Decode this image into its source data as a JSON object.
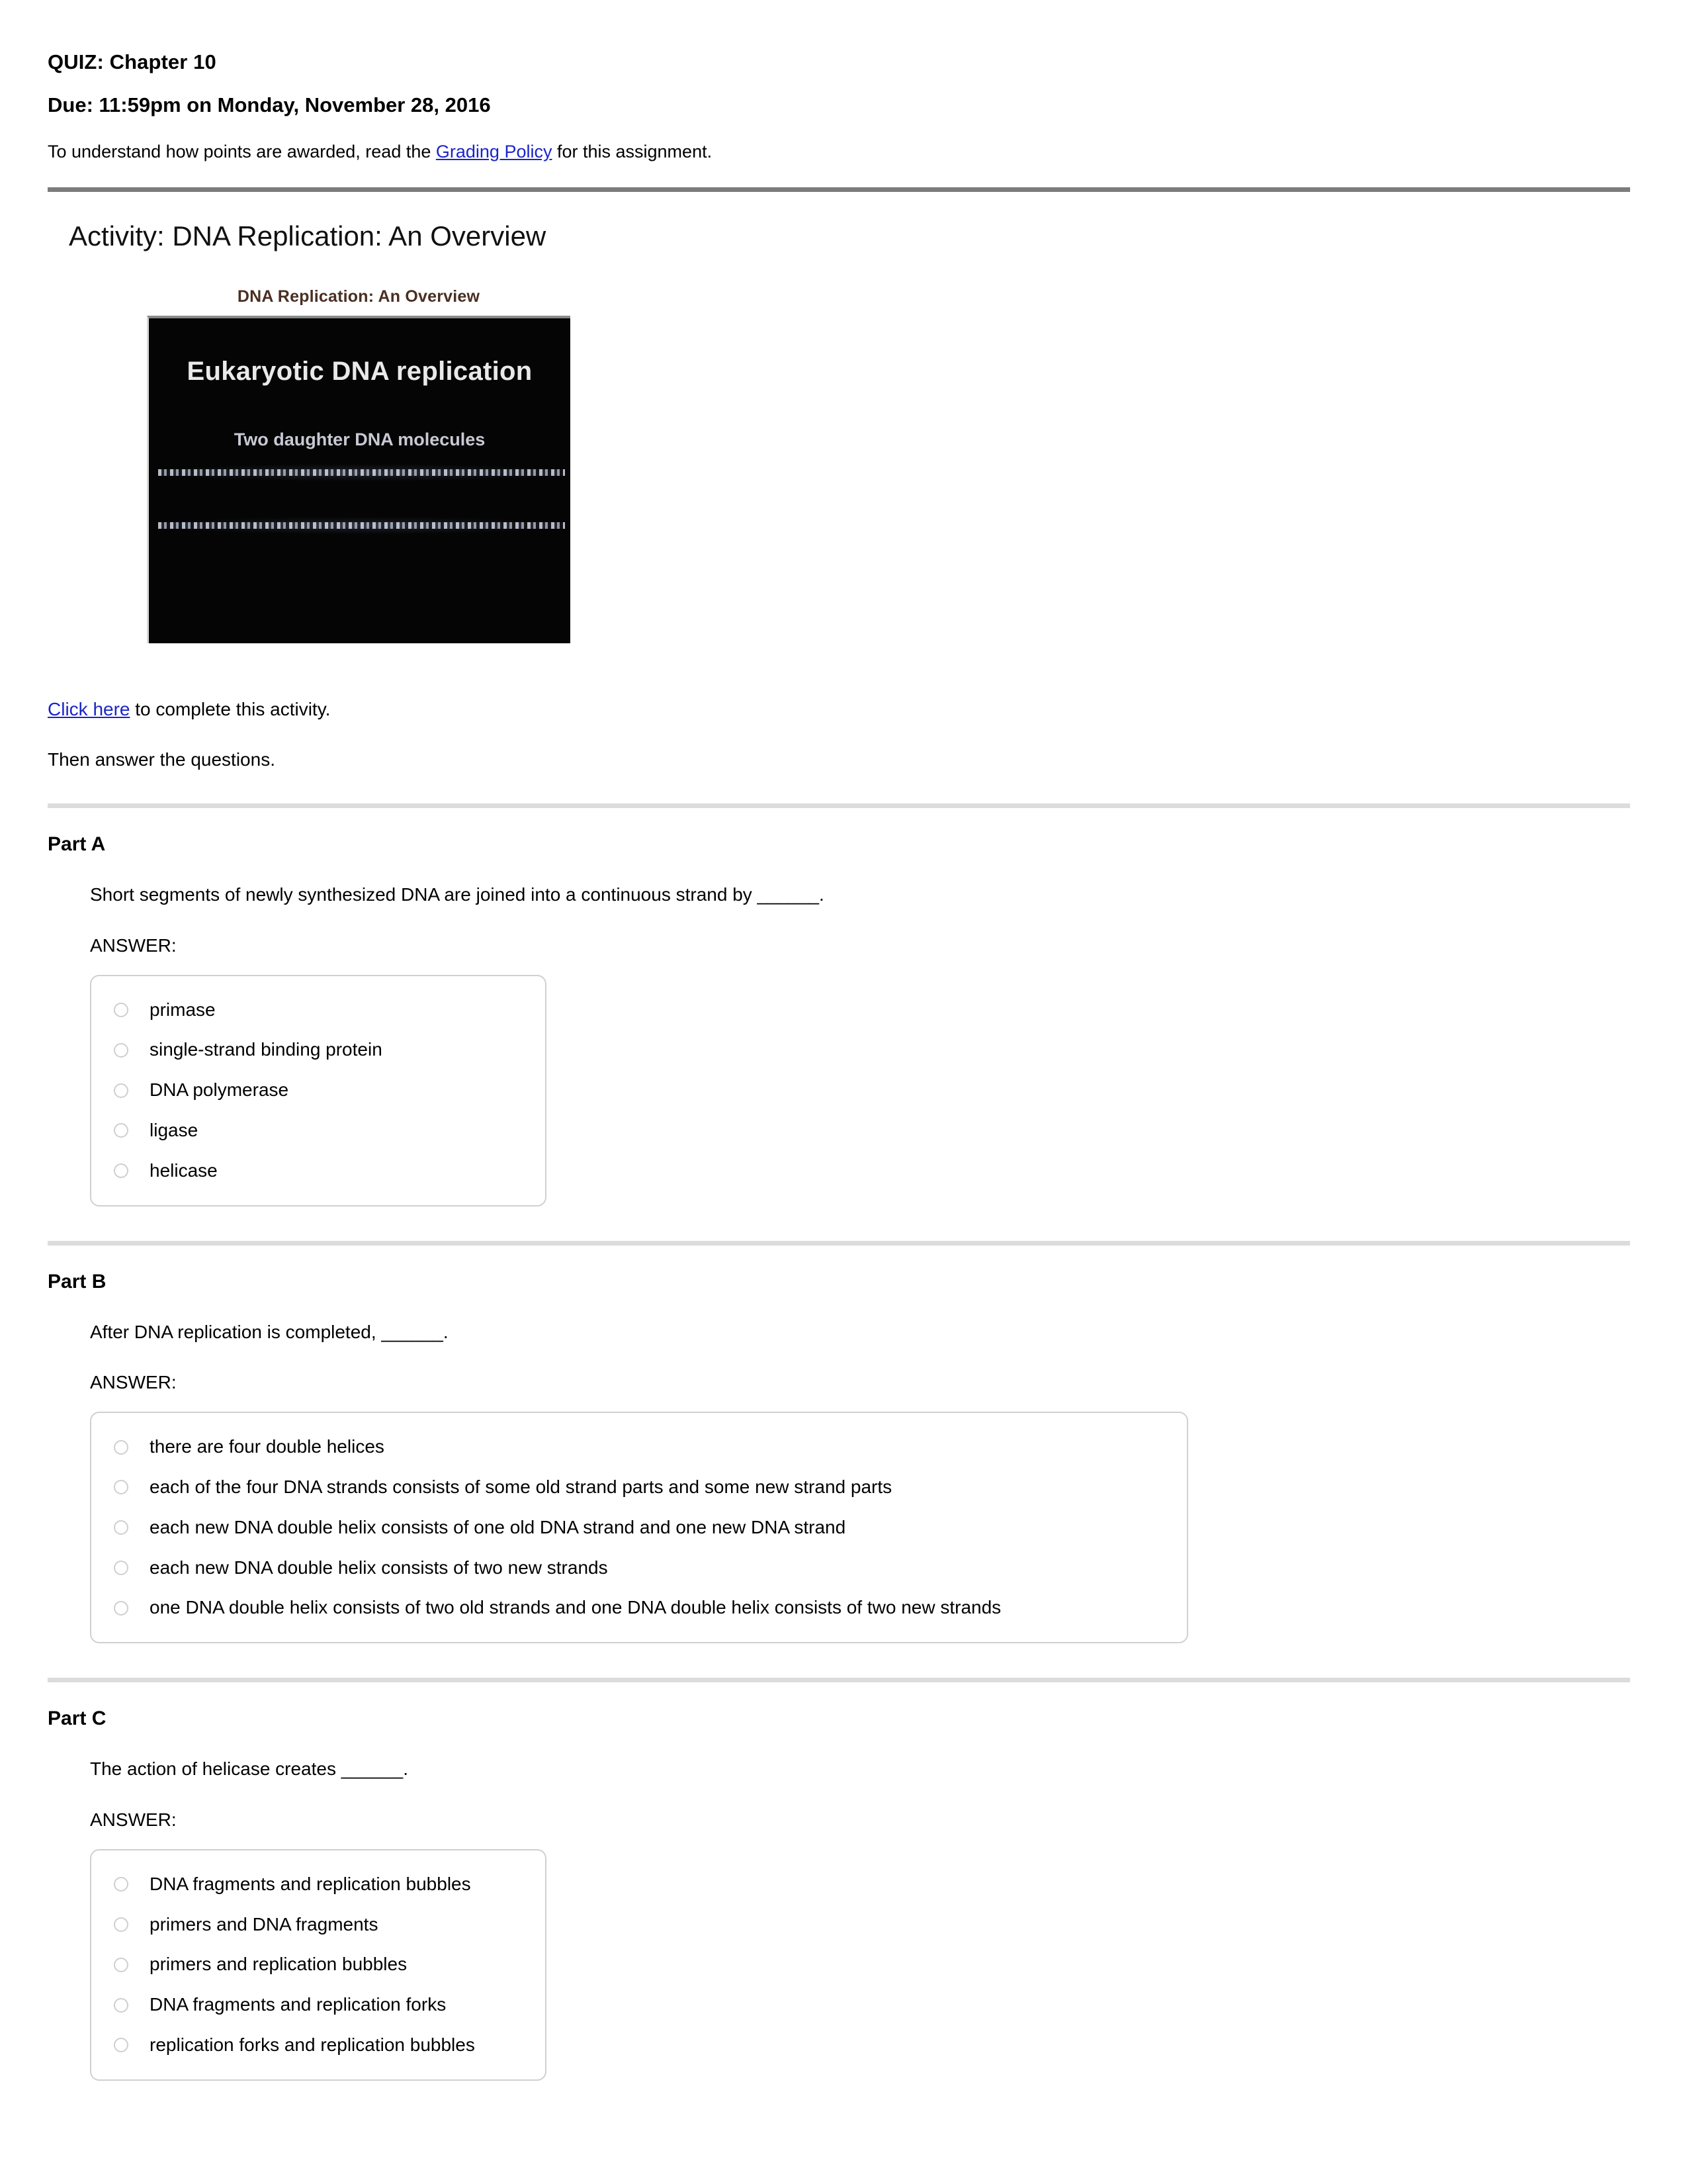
{
  "header": {
    "quiz_title": "QUIZ: Chapter 10",
    "due": "Due: 11:59pm on Monday, November 28, 2016",
    "grading_prefix": "To understand how points are awarded, read the ",
    "grading_link": "Grading Policy",
    "grading_suffix": " for this assignment."
  },
  "activity": {
    "title": "Activity: DNA Replication: An Overview",
    "thumbnail": {
      "caption": "DNA Replication: An Overview",
      "heading": "Eukaryotic DNA replication",
      "subheading": "Two daughter DNA molecules"
    },
    "click_link": "Click here",
    "click_suffix": " to complete this activity.",
    "then_line": "Then answer the questions."
  },
  "parts": [
    {
      "label": "Part A",
      "question": "Short segments of newly synthesized DNA are joined into a continuous strand by ______.",
      "answer_label": "ANSWER:",
      "box_width": "narrow",
      "options": [
        "primase",
        "single-strand binding protein",
        "DNA polymerase",
        "ligase",
        "helicase"
      ]
    },
    {
      "label": "Part B",
      "question": "After DNA replication is completed, ______.",
      "answer_label": "ANSWER:",
      "box_width": "wide",
      "options": [
        "there are four double helices",
        "each of the four DNA strands consists of some old strand parts and some new strand parts",
        "each new DNA double helix consists of one old DNA strand and one new DNA strand",
        "each new DNA double helix consists of two new strands",
        "one DNA double helix consists of two old strands and one DNA double helix consists of two new strands"
      ]
    },
    {
      "label": "Part C",
      "question": "The action of helicase creates ______.",
      "answer_label": "ANSWER:",
      "box_width": "narrow",
      "options": [
        "DNA fragments and replication bubbles",
        "primers and DNA fragments",
        "primers and replication bubbles",
        "DNA fragments and replication forks",
        "replication forks and replication bubbles"
      ]
    }
  ],
  "colors": {
    "link": "#1a25c8",
    "rule_thick": "#7c7c7c",
    "rule_thin": "#dcdcdc",
    "caption": "#4a2f22"
  }
}
